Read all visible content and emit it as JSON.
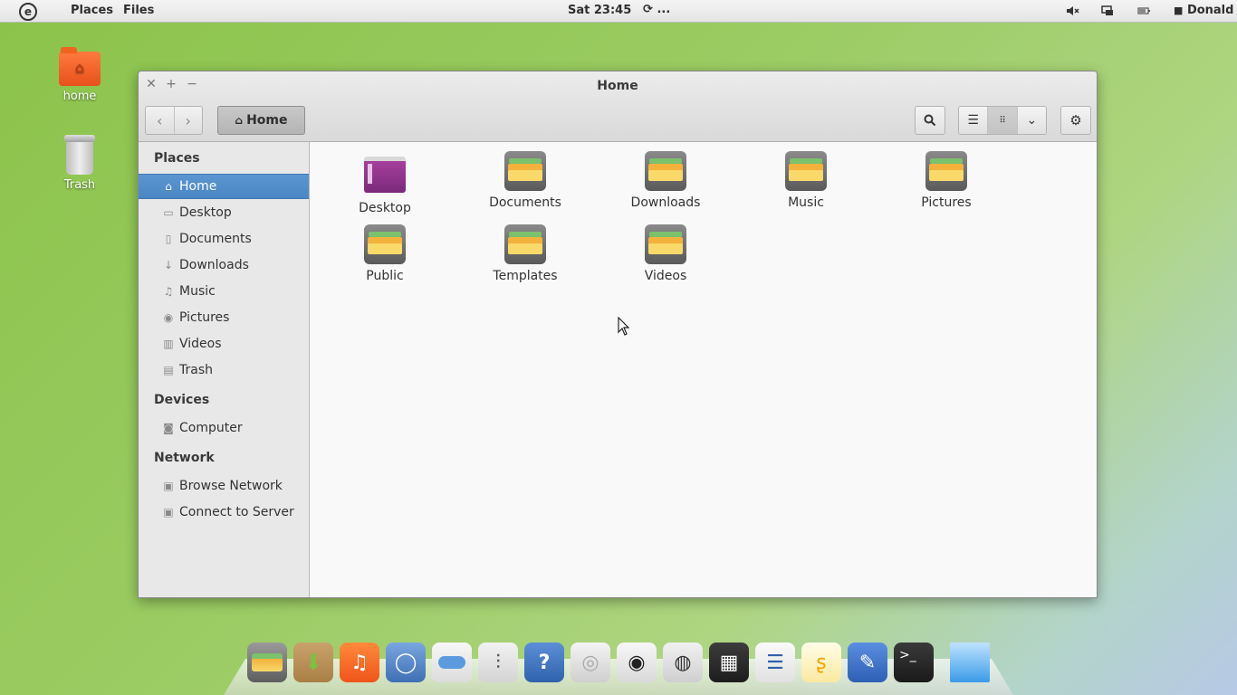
{
  "top_panel": {
    "menu_places": "Places",
    "menu_files": "Files",
    "clock": "Sat 23:45",
    "sync_text": "...",
    "user": "Donald"
  },
  "desktop": {
    "icons": [
      {
        "label": "home",
        "icon": "home-folder-icon"
      },
      {
        "label": "Trash",
        "icon": "trash-icon"
      }
    ]
  },
  "window": {
    "title": "Home",
    "path_button": "Home",
    "sidebar": {
      "places_header": "Places",
      "places": [
        {
          "label": "Home",
          "icon": "home-icon",
          "selected": true
        },
        {
          "label": "Desktop",
          "icon": "desktop-icon"
        },
        {
          "label": "Documents",
          "icon": "document-icon"
        },
        {
          "label": "Downloads",
          "icon": "download-icon"
        },
        {
          "label": "Music",
          "icon": "music-icon"
        },
        {
          "label": "Pictures",
          "icon": "camera-icon"
        },
        {
          "label": "Videos",
          "icon": "film-icon"
        },
        {
          "label": "Trash",
          "icon": "trash-icon"
        }
      ],
      "devices_header": "Devices",
      "devices": [
        {
          "label": "Computer",
          "icon": "drive-icon"
        }
      ],
      "network_header": "Network",
      "network": [
        {
          "label": "Browse Network",
          "icon": "network-icon"
        },
        {
          "label": "Connect to Server",
          "icon": "server-icon"
        }
      ]
    },
    "files": [
      {
        "label": "Desktop"
      },
      {
        "label": "Documents"
      },
      {
        "label": "Downloads"
      },
      {
        "label": "Music"
      },
      {
        "label": "Pictures"
      },
      {
        "label": "Public"
      },
      {
        "label": "Templates"
      },
      {
        "label": "Videos"
      }
    ]
  },
  "colors": {
    "selection": "#4a86c4",
    "desktop_bg": "#8bc34a"
  }
}
